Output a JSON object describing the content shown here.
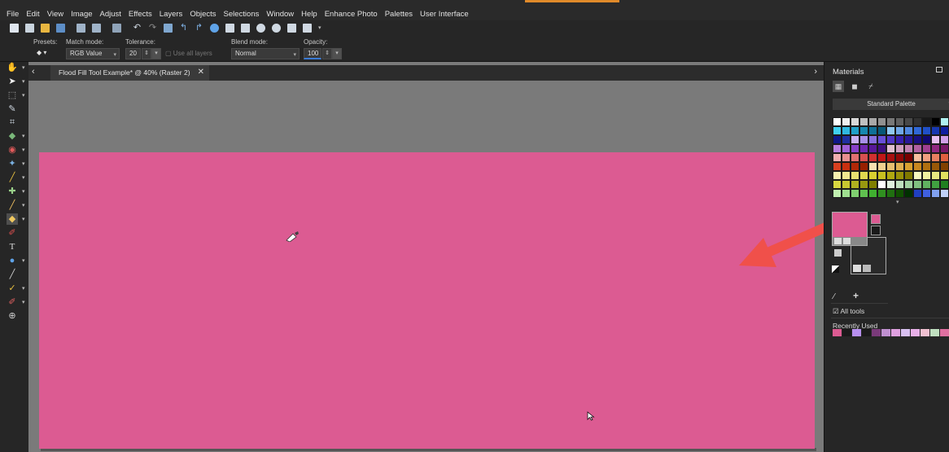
{
  "menu": [
    "File",
    "Edit",
    "View",
    "Image",
    "Adjust",
    "Effects",
    "Layers",
    "Objects",
    "Selections",
    "Window",
    "Help",
    "Enhance Photo",
    "Palettes",
    "User Interface"
  ],
  "options": {
    "presets_label": "Presets:",
    "match_mode_label": "Match mode:",
    "match_mode_value": "RGB Value",
    "tolerance_label": "Tolerance:",
    "tolerance_value": "20",
    "use_all_layers_label": "Use all layers",
    "blend_mode_label": "Blend mode:",
    "blend_mode_value": "Normal",
    "opacity_label": "Opacity:",
    "opacity_value": "100"
  },
  "document": {
    "tab_title": "Flood Fill Tool Example* @ 40% (Raster 2)",
    "fill_color": "#dc5b92"
  },
  "materials": {
    "title": "Materials",
    "palette_name": "Standard Palette",
    "foreground_color": "#dc5b92",
    "background_color": "#2a2a2a",
    "all_tools_label": "All tools",
    "recently_used_label": "Recently Used"
  },
  "annotation": {
    "arrow_color": "#f0504a"
  }
}
